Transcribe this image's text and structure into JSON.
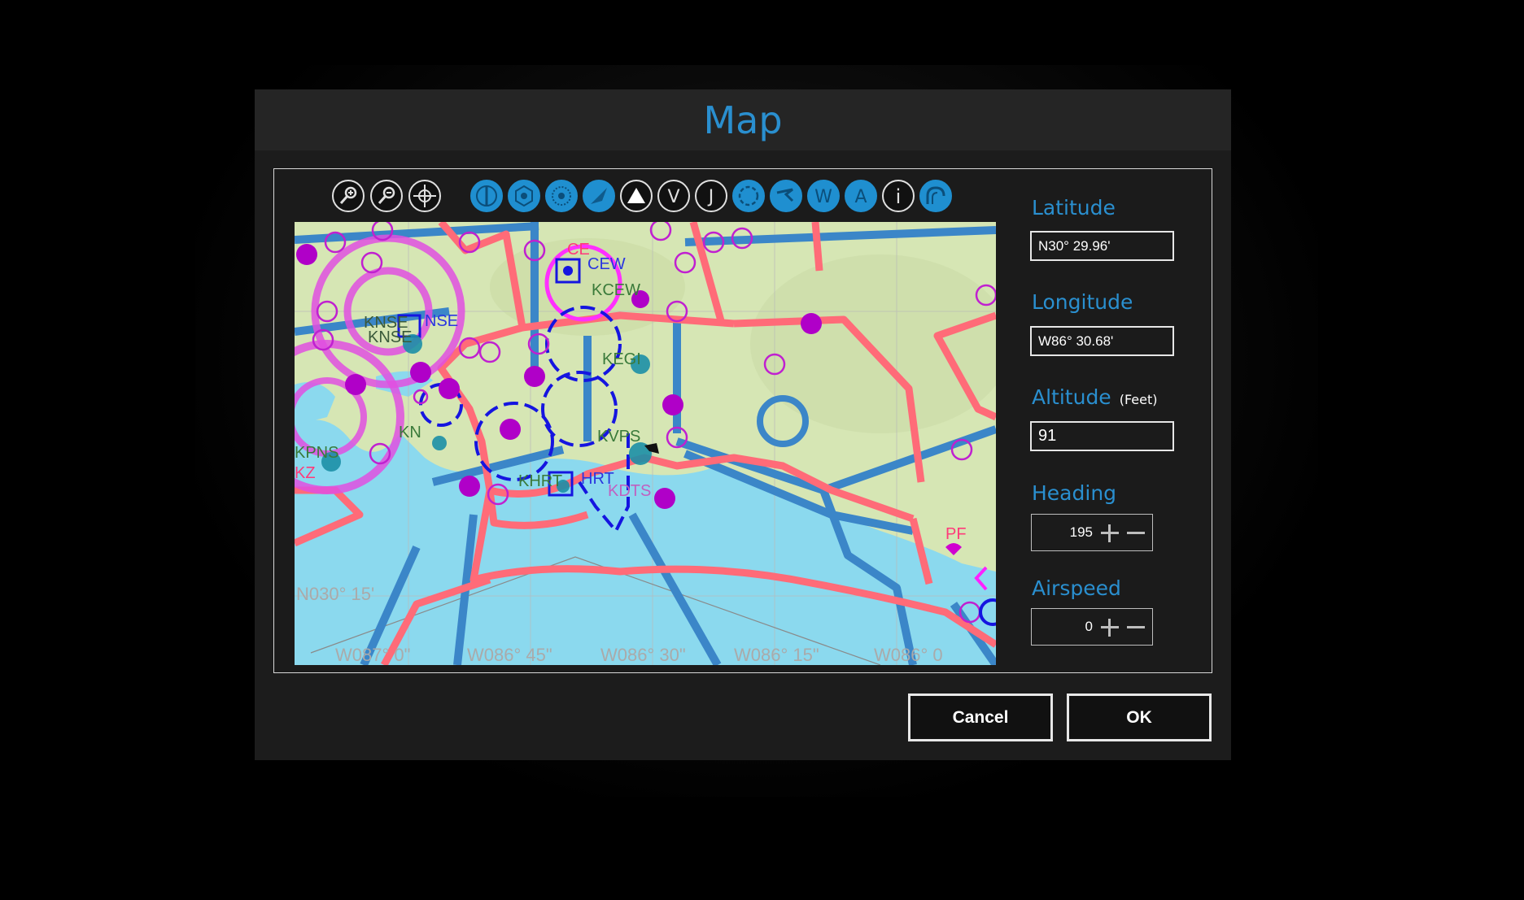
{
  "dialog": {
    "title": "Map"
  },
  "toolbar": {
    "tools": [
      {
        "name": "zoom-in-icon"
      },
      {
        "name": "zoom-out-icon"
      },
      {
        "name": "center-icon"
      }
    ],
    "layers": [
      {
        "name": "layer-split-icon",
        "style": "filled"
      },
      {
        "name": "layer-hexagon-icon",
        "style": "filled"
      },
      {
        "name": "layer-ndb-icon",
        "style": "filled"
      },
      {
        "name": "layer-route-icon",
        "style": "filled"
      },
      {
        "name": "layer-triangle-icon",
        "style": "outline"
      },
      {
        "name": "layer-victor-icon",
        "style": "outline",
        "letter": "V"
      },
      {
        "name": "layer-jet-icon",
        "style": "outline",
        "letter": "J"
      },
      {
        "name": "layer-class-c-icon",
        "style": "filled"
      },
      {
        "name": "layer-restricted-icon",
        "style": "filled"
      },
      {
        "name": "layer-warning-icon",
        "style": "filled",
        "letter": "W"
      },
      {
        "name": "layer-alert-icon",
        "style": "filled",
        "letter": "A"
      },
      {
        "name": "layer-info-icon",
        "style": "outline",
        "letter": "i"
      },
      {
        "name": "layer-terrain-icon",
        "style": "filled"
      }
    ]
  },
  "map": {
    "labels": {
      "cew_small": "CE",
      "cew": "CEW",
      "kcew": "KCEW",
      "knse_a": "KNSE",
      "knse_b": "KNSE",
      "nse": "NSE",
      "kegi": "KEGI",
      "kvps": "KVPS",
      "kn": "KN",
      "kpns": "KPNS",
      "kz": "KZ",
      "khrt": "KHRT",
      "hrt": "HRT",
      "kdts": "KDTS",
      "pf": "PF",
      "lat_line": "N030° 15'",
      "lon_87": "W087° 0\"",
      "lon_8645": "W086° 45\"",
      "lon_8630": "W086° 30\"",
      "lon_8615": "W086° 15\"",
      "lon_86": "W086° 0"
    }
  },
  "fields": {
    "latitude": {
      "label": "Latitude",
      "value": "N30° 29.96'"
    },
    "longitude": {
      "label": "Longitude",
      "value": "W86° 30.68'"
    },
    "altitude": {
      "label": "Altitude",
      "unit": "(Feet)",
      "value": "91"
    },
    "heading": {
      "label": "Heading",
      "value": "195"
    },
    "airspeed": {
      "label": "Airspeed",
      "value": "0"
    }
  },
  "buttons": {
    "cancel": "Cancel",
    "ok": "OK"
  },
  "colors": {
    "accent": "#2a8fcf",
    "land": "#d6e6b4",
    "water": "#8bd9ee",
    "airway_blue": "#3b86c8",
    "boundary_red": "#ff6b78",
    "class_magenta": "#d000d0"
  }
}
